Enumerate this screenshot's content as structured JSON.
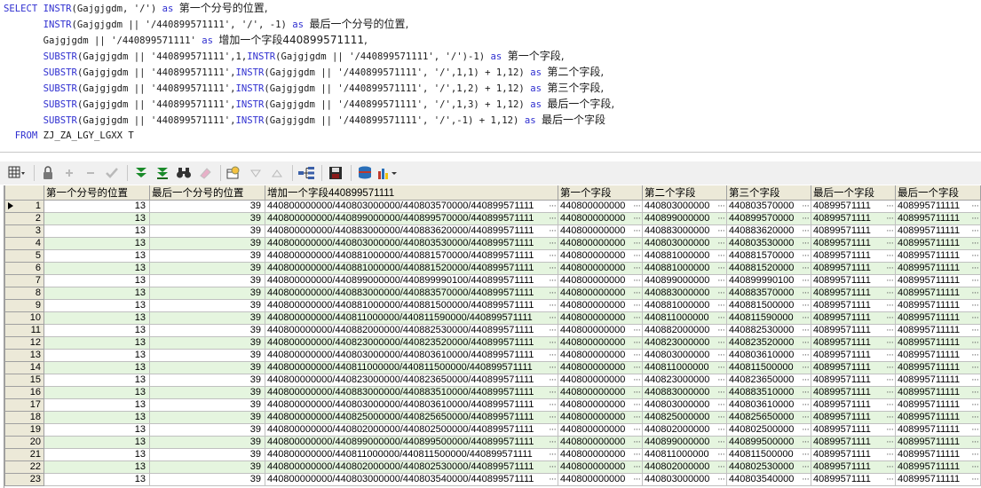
{
  "sql": {
    "lines": [
      [
        {
          "t": "SELECT ",
          "c": "kw"
        },
        {
          "t": "INSTR",
          "c": "kw"
        },
        {
          "t": "(Gajgjgdm, '/') "
        },
        {
          "t": "as ",
          "c": "kw"
        },
        {
          "t": "第一个分号的位置,",
          "c": "cn"
        }
      ],
      [
        {
          "t": "       "
        },
        {
          "t": "INSTR",
          "c": "kw"
        },
        {
          "t": "(Gajgjgdm || '/440899571111', '/', -1) "
        },
        {
          "t": "as ",
          "c": "kw"
        },
        {
          "t": "最后一个分号的位置,",
          "c": "cn"
        }
      ],
      [
        {
          "t": "       Gajgjgdm || '/440899571111' "
        },
        {
          "t": "as ",
          "c": "kw"
        },
        {
          "t": "增加一个字段440899571111,",
          "c": "cn"
        }
      ],
      [
        {
          "t": "       "
        },
        {
          "t": "SUBSTR",
          "c": "kw"
        },
        {
          "t": "(Gajgjgdm || '440899571111',1,"
        },
        {
          "t": "INSTR",
          "c": "kw"
        },
        {
          "t": "(Gajgjgdm || '/440899571111', '/')-1) "
        },
        {
          "t": "as ",
          "c": "kw"
        },
        {
          "t": "第一个字段,",
          "c": "cn"
        }
      ],
      [
        {
          "t": "       "
        },
        {
          "t": "SUBSTR",
          "c": "kw"
        },
        {
          "t": "(Gajgjgdm || '440899571111',"
        },
        {
          "t": "INSTR",
          "c": "kw"
        },
        {
          "t": "(Gajgjgdm || '/440899571111', '/',1,1) + 1,12) "
        },
        {
          "t": "as ",
          "c": "kw"
        },
        {
          "t": "第二个字段,",
          "c": "cn"
        }
      ],
      [
        {
          "t": "       "
        },
        {
          "t": "SUBSTR",
          "c": "kw"
        },
        {
          "t": "(Gajgjgdm || '440899571111',"
        },
        {
          "t": "INSTR",
          "c": "kw"
        },
        {
          "t": "(Gajgjgdm || '/440899571111', '/',1,2) + 1,12) "
        },
        {
          "t": "as ",
          "c": "kw"
        },
        {
          "t": "第三个字段,",
          "c": "cn"
        }
      ],
      [
        {
          "t": "       "
        },
        {
          "t": "SUBSTR",
          "c": "kw"
        },
        {
          "t": "(Gajgjgdm || '440899571111',"
        },
        {
          "t": "INSTR",
          "c": "kw"
        },
        {
          "t": "(Gajgjgdm || '/440899571111', '/',1,3) + 1,12) "
        },
        {
          "t": "as ",
          "c": "kw"
        },
        {
          "t": "最后一个字段,",
          "c": "cn"
        }
      ],
      [
        {
          "t": "       "
        },
        {
          "t": "SUBSTR",
          "c": "kw"
        },
        {
          "t": "(Gajgjgdm || '440899571111',"
        },
        {
          "t": "INSTR",
          "c": "kw"
        },
        {
          "t": "(Gajgjgdm || '/440899571111', '/',-1) + 1,12) "
        },
        {
          "t": "as ",
          "c": "kw"
        },
        {
          "t": "最后一个字段",
          "c": "cn"
        }
      ],
      [
        {
          "t": "  "
        },
        {
          "t": "FROM ",
          "c": "kw"
        },
        {
          "t": "ZJ_ZA_LGY_LGXX T"
        }
      ]
    ]
  },
  "toolbar": {
    "buttons": [
      {
        "name": "grid-view-dropdown-button",
        "icon": "grid-icon",
        "disabled": false
      },
      {
        "name": "sep"
      },
      {
        "name": "lock-button",
        "icon": "lock-icon",
        "disabled": false
      },
      {
        "name": "add-record-button",
        "icon": "plus-icon",
        "disabled": true
      },
      {
        "name": "delete-record-button",
        "icon": "minus-icon",
        "disabled": true
      },
      {
        "name": "post-changes-button",
        "icon": "check-icon",
        "disabled": true
      },
      {
        "name": "sep"
      },
      {
        "name": "fetch-next-page-button",
        "icon": "double-chevron-down-icon",
        "disabled": false
      },
      {
        "name": "fetch-last-page-button",
        "icon": "chevron-down-bar-icon",
        "disabled": false
      },
      {
        "name": "find-button",
        "icon": "binoculars-icon",
        "disabled": false
      },
      {
        "name": "clear-button",
        "icon": "eraser-icon",
        "disabled": true
      },
      {
        "name": "sep"
      },
      {
        "name": "query-by-example-button",
        "icon": "qbe-icon",
        "disabled": false
      },
      {
        "name": "previous-record-button",
        "icon": "triangle-down-icon",
        "disabled": true
      },
      {
        "name": "next-record-button",
        "icon": "triangle-up-icon",
        "disabled": true
      },
      {
        "name": "sep"
      },
      {
        "name": "single-record-view-button",
        "icon": "tree-icon",
        "disabled": false
      },
      {
        "name": "sep"
      },
      {
        "name": "export-button",
        "icon": "floppy-icon",
        "disabled": false
      },
      {
        "name": "sep"
      },
      {
        "name": "connect-button",
        "icon": "database-icon",
        "disabled": false
      },
      {
        "name": "chart-dropdown-button",
        "icon": "chart-icon",
        "disabled": false
      }
    ]
  },
  "grid": {
    "columns": [
      "第一个分号的位置",
      "最后一个分号的位置",
      "增加一个字段440899571111",
      "第一个字段",
      "第二个字段",
      "第三个字段",
      "最后一个字段",
      "最后一个字段"
    ],
    "rows": [
      [
        "1",
        "13",
        "39",
        "440800000000/440803000000/440803570000/440899571111",
        "440800000000",
        "440803000000",
        "440803570000",
        "40899571111",
        "408995711111"
      ],
      [
        "2",
        "13",
        "39",
        "440800000000/440899000000/440899570000/440899571111",
        "440800000000",
        "440899000000",
        "440899570000",
        "40899571111",
        "408995711111"
      ],
      [
        "3",
        "13",
        "39",
        "440800000000/440883000000/440883620000/440899571111",
        "440800000000",
        "440883000000",
        "440883620000",
        "40899571111",
        "408995711111"
      ],
      [
        "4",
        "13",
        "39",
        "440800000000/440803000000/440803530000/440899571111",
        "440800000000",
        "440803000000",
        "440803530000",
        "40899571111",
        "408995711111"
      ],
      [
        "5",
        "13",
        "39",
        "440800000000/440881000000/440881570000/440899571111",
        "440800000000",
        "440881000000",
        "440881570000",
        "40899571111",
        "408995711111"
      ],
      [
        "6",
        "13",
        "39",
        "440800000000/440881000000/440881520000/440899571111",
        "440800000000",
        "440881000000",
        "440881520000",
        "40899571111",
        "408995711111"
      ],
      [
        "7",
        "13",
        "39",
        "440800000000/440899000000/440899990100/440899571111",
        "440800000000",
        "440899000000",
        "440899990100",
        "40899571111",
        "408995711111"
      ],
      [
        "8",
        "13",
        "39",
        "440800000000/440883000000/440883570000/440899571111",
        "440800000000",
        "440883000000",
        "440883570000",
        "40899571111",
        "408995711111"
      ],
      [
        "9",
        "13",
        "39",
        "440800000000/440881000000/440881500000/440899571111",
        "440800000000",
        "440881000000",
        "440881500000",
        "40899571111",
        "408995711111"
      ],
      [
        "10",
        "13",
        "39",
        "440800000000/440811000000/440811590000/440899571111",
        "440800000000",
        "440811000000",
        "440811590000",
        "40899571111",
        "408995711111"
      ],
      [
        "11",
        "13",
        "39",
        "440800000000/440882000000/440882530000/440899571111",
        "440800000000",
        "440882000000",
        "440882530000",
        "40899571111",
        "408995711111"
      ],
      [
        "12",
        "13",
        "39",
        "440800000000/440823000000/440823520000/440899571111",
        "440800000000",
        "440823000000",
        "440823520000",
        "40899571111",
        "408995711111"
      ],
      [
        "13",
        "13",
        "39",
        "440800000000/440803000000/440803610000/440899571111",
        "440800000000",
        "440803000000",
        "440803610000",
        "40899571111",
        "408995711111"
      ],
      [
        "14",
        "13",
        "39",
        "440800000000/440811000000/440811500000/440899571111",
        "440800000000",
        "440811000000",
        "440811500000",
        "40899571111",
        "408995711111"
      ],
      [
        "15",
        "13",
        "39",
        "440800000000/440823000000/440823650000/440899571111",
        "440800000000",
        "440823000000",
        "440823650000",
        "40899571111",
        "408995711111"
      ],
      [
        "16",
        "13",
        "39",
        "440800000000/440883000000/440883510000/440899571111",
        "440800000000",
        "440883000000",
        "440883510000",
        "40899571111",
        "408995711111"
      ],
      [
        "17",
        "13",
        "39",
        "440800000000/440803000000/440803610000/440899571111",
        "440800000000",
        "440803000000",
        "440803610000",
        "40899571111",
        "408995711111"
      ],
      [
        "18",
        "13",
        "39",
        "440800000000/440825000000/440825650000/440899571111",
        "440800000000",
        "440825000000",
        "440825650000",
        "40899571111",
        "408995711111"
      ],
      [
        "19",
        "13",
        "39",
        "440800000000/440802000000/440802500000/440899571111",
        "440800000000",
        "440802000000",
        "440802500000",
        "40899571111",
        "408995711111"
      ],
      [
        "20",
        "13",
        "39",
        "440800000000/440899000000/440899500000/440899571111",
        "440800000000",
        "440899000000",
        "440899500000",
        "40899571111",
        "408995711111"
      ],
      [
        "21",
        "13",
        "39",
        "440800000000/440811000000/440811500000/440899571111",
        "440800000000",
        "440811000000",
        "440811500000",
        "40899571111",
        "408995711111"
      ],
      [
        "22",
        "13",
        "39",
        "440800000000/440802000000/440802530000/440899571111",
        "440800000000",
        "440802000000",
        "440802530000",
        "40899571111",
        "408995711111"
      ],
      [
        "23",
        "13",
        "39",
        "440800000000/440803000000/440803540000/440899571111",
        "440800000000",
        "440803000000",
        "440803540000",
        "40899571111",
        "408995711111"
      ]
    ],
    "ellipsis": "···",
    "colors": {
      "even_row": "#e5f5df",
      "odd_row": "#ffffff",
      "header": "#ece9d8",
      "keyword": "#2f2fd0"
    }
  }
}
